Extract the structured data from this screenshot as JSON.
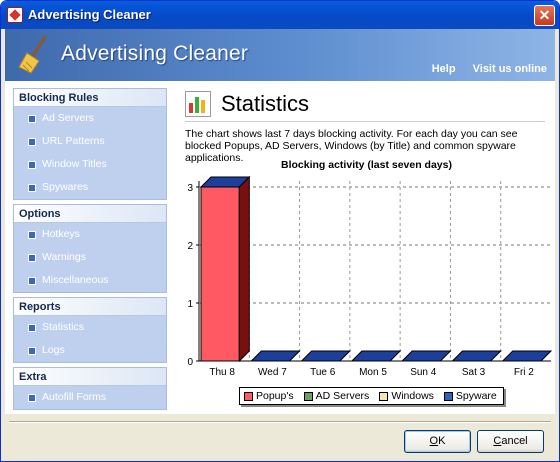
{
  "window": {
    "title": "Advertising Cleaner",
    "close_symbol": "✕"
  },
  "banner": {
    "brand": "Advertising Cleaner",
    "help": "Help",
    "visit": "Visit us online"
  },
  "sidebar": {
    "groups": [
      {
        "title": "Blocking Rules",
        "items": [
          "Ad Servers",
          "URL Patterns",
          "Window Titles",
          "Spywares"
        ]
      },
      {
        "title": "Options",
        "items": [
          "Hotkeys",
          "Warnings",
          "Miscellaneous"
        ]
      },
      {
        "title": "Reports",
        "items": [
          "Statistics",
          "Logs"
        ]
      },
      {
        "title": "Extra",
        "items": [
          "Autofill Forms"
        ]
      }
    ]
  },
  "main": {
    "title": "Statistics",
    "description": "The chart shows last 7 days blocking activity. For each day you can see blocked Popups, AD Servers, Windows (by Title) and common spyware applications."
  },
  "chart_data": {
    "type": "bar",
    "title": "Blocking activity (last seven days)",
    "categories": [
      "Thu 8",
      "Wed 7",
      "Tue 6",
      "Mon 5",
      "Sun 4",
      "Sat 3",
      "Fri 2"
    ],
    "series": [
      {
        "name": "Popup's",
        "values": [
          3,
          0,
          0,
          0,
          0,
          0,
          0
        ],
        "color": "#ff5a64"
      },
      {
        "name": "AD Servers",
        "values": [
          0,
          0,
          0,
          0,
          0,
          0,
          0
        ],
        "color": "#6ca067"
      },
      {
        "name": "Windows",
        "values": [
          0,
          0,
          0,
          0,
          0,
          0,
          0
        ],
        "color": "#f7e6b0"
      },
      {
        "name": "Spyware",
        "values": [
          0,
          0,
          0,
          0,
          0,
          0,
          0
        ],
        "color": "#2e63b8"
      }
    ],
    "yticks": [
      0,
      1,
      2,
      3
    ],
    "ylim": [
      0,
      3
    ],
    "grid": true,
    "legend": "bottom"
  },
  "buttons": {
    "ok_prefix": "O",
    "ok_rest": "K",
    "cancel_prefix": "C",
    "cancel_rest": "ancel"
  }
}
